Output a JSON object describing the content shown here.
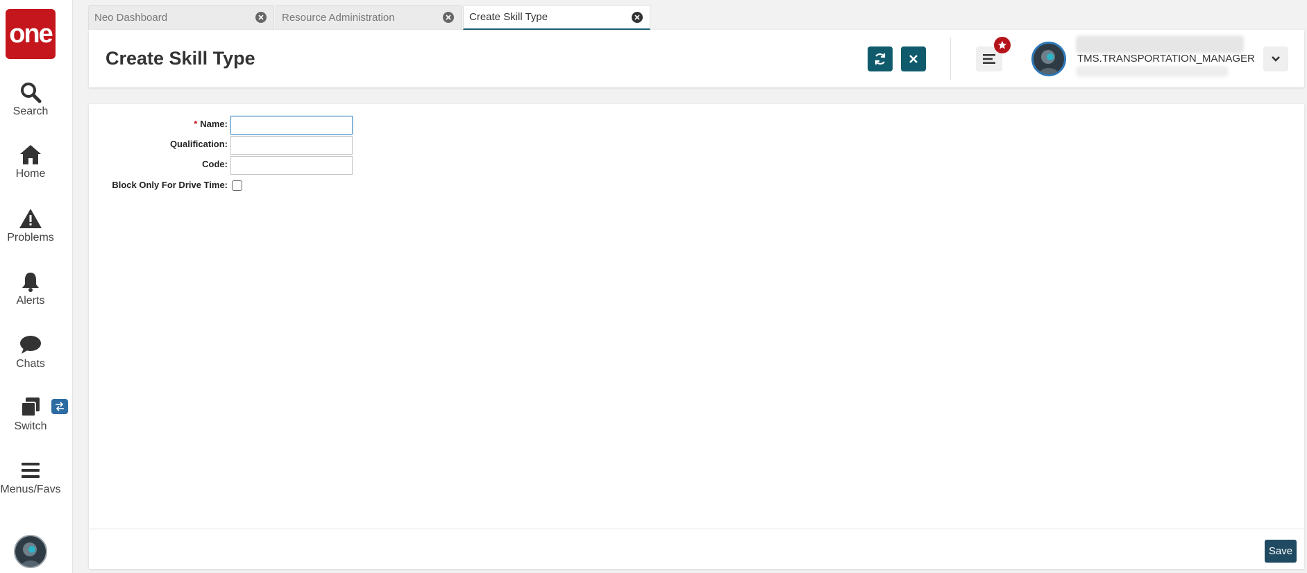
{
  "brand": {
    "logo_text": "one",
    "color": "#c4161c"
  },
  "nav": {
    "items": [
      {
        "label": "Search",
        "icon": "search-icon"
      },
      {
        "label": "Home",
        "icon": "home-icon"
      },
      {
        "label": "Problems",
        "icon": "warning-icon"
      },
      {
        "label": "Alerts",
        "icon": "bell-icon"
      },
      {
        "label": "Chats",
        "icon": "chat-icon"
      },
      {
        "label": "Switch",
        "icon": "switch-icon"
      },
      {
        "label": "Menus/Favs",
        "icon": "hamburger-icon"
      }
    ]
  },
  "tabs": [
    {
      "label": "Neo Dashboard",
      "active": false
    },
    {
      "label": "Resource Administration",
      "active": false
    },
    {
      "label": "Create Skill Type",
      "active": true
    }
  ],
  "header": {
    "title": "Create Skill Type",
    "user_role": "TMS.TRANSPORTATION_MANAGER",
    "accent_color": "#0f5b6b"
  },
  "form": {
    "name_label": "Name:",
    "name_required_mark": "*",
    "name_value": "",
    "qualification_label": "Qualification:",
    "qualification_value": "",
    "code_label": "Code:",
    "code_value": "",
    "block_label": "Block Only For Drive Time:",
    "block_checked": false
  },
  "footer": {
    "save_label": "Save"
  }
}
